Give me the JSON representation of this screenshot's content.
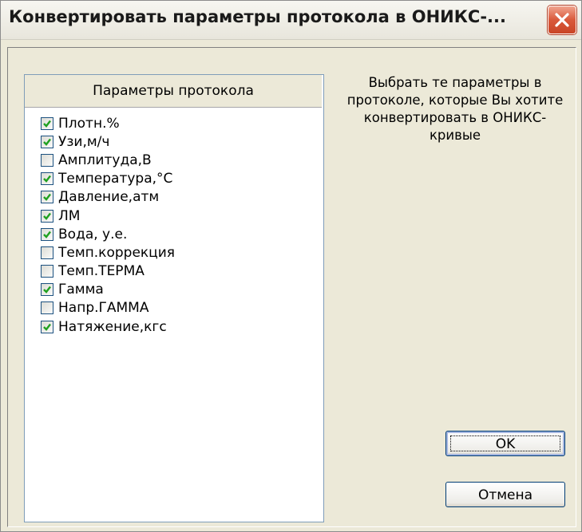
{
  "window": {
    "title": "Конвертировать параметры протокола в ОНИКС-..."
  },
  "list": {
    "header": "Параметры протокола",
    "items": [
      {
        "label": "Плотн.%",
        "checked": true
      },
      {
        "label": "Узи,м/ч",
        "checked": true
      },
      {
        "label": "Амплитуда,В",
        "checked": false
      },
      {
        "label": "Температура,°C",
        "checked": true
      },
      {
        "label": "Давление,атм",
        "checked": true
      },
      {
        "label": "ЛМ",
        "checked": true
      },
      {
        "label": "Вода, у.е.",
        "checked": true
      },
      {
        "label": "Темп.коррекция",
        "checked": false
      },
      {
        "label": "Темп.ТЕРМА",
        "checked": false
      },
      {
        "label": "Гамма",
        "checked": true
      },
      {
        "label": "Напр.ГАММА",
        "checked": false
      },
      {
        "label": "Натяжение,кгс",
        "checked": true
      }
    ]
  },
  "hint": "Выбрать те параметры в протоколе, которые Вы хотите конвертировать в ОНИКС-кривые",
  "buttons": {
    "ok_label": "OK",
    "cancel_label": "Отмена"
  },
  "icons": {
    "close": "close-icon",
    "check": "checkmark-icon"
  },
  "colors": {
    "checkmark": "#21a121",
    "close_button": "#d9593b"
  }
}
